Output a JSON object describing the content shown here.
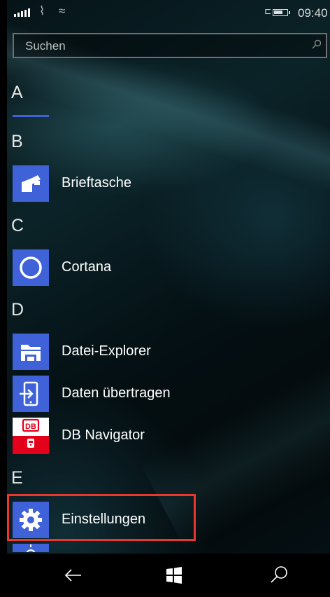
{
  "status_bar": {
    "time": "09:40"
  },
  "search": {
    "placeholder": "Suchen"
  },
  "sections": [
    {
      "letter": "A",
      "items": []
    },
    {
      "letter": "B",
      "items": [
        {
          "label": "Brieftasche",
          "icon": "wallet-icon"
        }
      ]
    },
    {
      "letter": "C",
      "items": [
        {
          "label": "Cortana",
          "icon": "cortana-icon"
        }
      ]
    },
    {
      "letter": "D",
      "items": [
        {
          "label": "Datei-Explorer",
          "icon": "file-explorer-icon"
        },
        {
          "label": "Daten übertragen",
          "icon": "transfer-data-icon"
        },
        {
          "label": "DB Navigator",
          "icon": "db-navigator-icon"
        }
      ]
    },
    {
      "letter": "E",
      "items": [
        {
          "label": "Einstellungen",
          "icon": "gear-icon"
        }
      ]
    }
  ],
  "highlight_color": "#e8382b",
  "tile_color": "#3f62d9",
  "nav": {
    "back": "back-arrow-icon",
    "start": "windows-logo-icon",
    "search": "search-icon"
  },
  "db_logo_text": "DB"
}
